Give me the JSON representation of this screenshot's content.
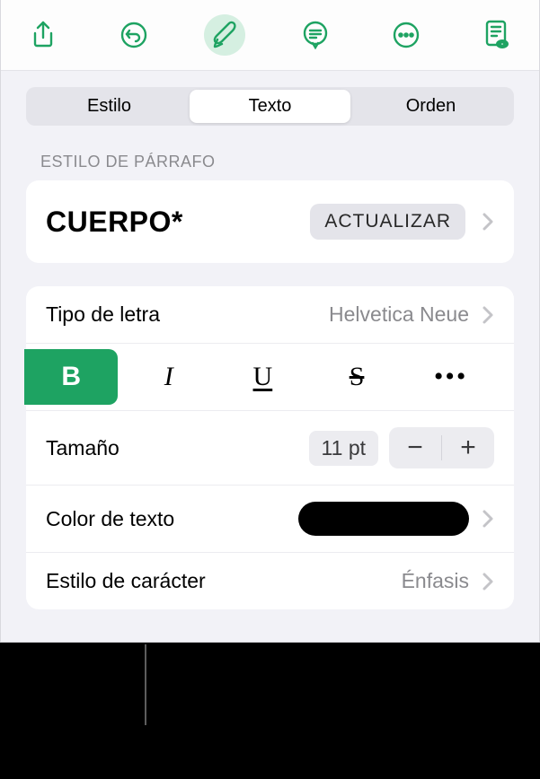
{
  "toolbarIcons": [
    "share",
    "undo",
    "format",
    "comment",
    "more",
    "view"
  ],
  "tabs": {
    "style": "Estilo",
    "text": "Texto",
    "order": "Orden"
  },
  "sections": {
    "paragraphStyle": "Estilo de párrafo"
  },
  "paragraph": {
    "name": "CUERPO*",
    "updateLabel": "ACTUALIZAR"
  },
  "font": {
    "label": "Tipo de letra",
    "value": "Helvetica Neue"
  },
  "size": {
    "label": "Tamaño",
    "value": "11 pt"
  },
  "textColor": {
    "label": "Color de texto",
    "value": "#000000"
  },
  "charStyle": {
    "label": "Estilo de carácter",
    "value": "Énfasis"
  },
  "accent": "#1ea362"
}
